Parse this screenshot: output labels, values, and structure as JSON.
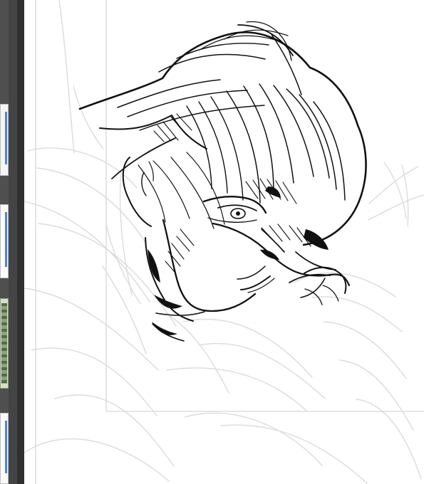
{
  "thumbnails": [
    {
      "name": "thumbnail-1",
      "state": "inactive"
    },
    {
      "name": "thumbnail-2",
      "state": "inactive"
    },
    {
      "name": "thumbnail-3",
      "state": "active"
    },
    {
      "name": "thumbnail-4",
      "state": "inactive"
    }
  ],
  "canvas": {
    "background": "#ffffff",
    "sketch_color": "#d9d9d9",
    "ink_color": "#111111"
  }
}
